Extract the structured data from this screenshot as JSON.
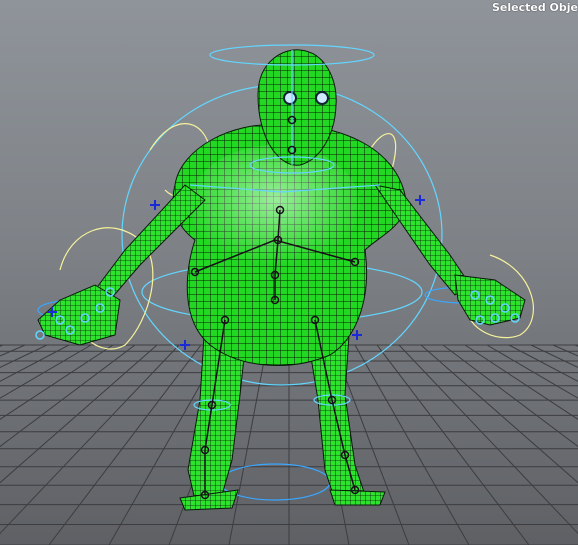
{
  "viewport": {
    "hud_label": "Selected Obje",
    "colors": {
      "background_top": "#8f949a",
      "background_bottom": "#5e6064",
      "grid_line": "#3c3d40",
      "mesh_fill": "#1fd61f",
      "mesh_wire": "#000000",
      "rig_control_cyan": "#63d6ff",
      "rig_control_yellow": "#f6f19b",
      "locator_blue": "#1a2ad6",
      "joint": "#1a0e1a"
    },
    "icons": [
      "halo-control",
      "joint-chain",
      "locator-cross"
    ]
  }
}
